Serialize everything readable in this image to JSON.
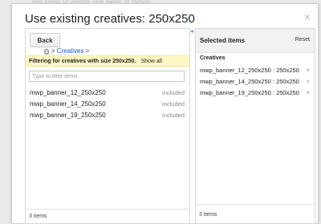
{
  "backdrop": {
    "text": "mwp_banner_12_250x250 · mwp_banner_14_250x250"
  },
  "dialog": {
    "title": "Use existing creatives: 250x250",
    "close_icon": "×"
  },
  "left_panel": {
    "back_label": "Back",
    "breadcrumb": {
      "home_icon": "home-icon",
      "sep1": ">",
      "link": "Creatives",
      "sep2": ">"
    },
    "filter_bar": {
      "message": "Filtering for creatives with size 250x250.",
      "show_all": "Show all"
    },
    "filter_input": {
      "placeholder": "Type to filter items",
      "value": ""
    },
    "items": [
      {
        "name": "mwp_banner_12_250x250",
        "status": "included"
      },
      {
        "name": "mwp_banner_14_250x250",
        "status": "included"
      },
      {
        "name": "mwp_banner_19_250x250",
        "status": "included"
      }
    ],
    "footer": "3 items"
  },
  "collapse_icon": "◂",
  "right_panel": {
    "title": "Selected items",
    "reset": "Reset",
    "section": "Creatives",
    "items": [
      {
        "name": "mwp_banner_12_250x250 : 250x250",
        "remove": "×"
      },
      {
        "name": "mwp_banner_14_250x250 : 250x250",
        "remove": "×"
      },
      {
        "name": "mwp_banner_19_250x250 : 250x250",
        "remove": "×"
      }
    ],
    "footer": "3 items"
  }
}
